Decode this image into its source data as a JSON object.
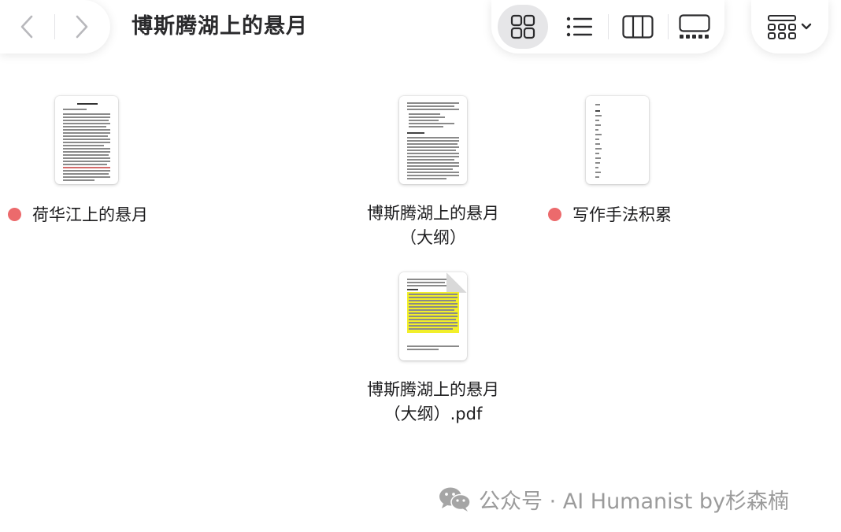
{
  "window": {
    "title": "博斯腾湖上的悬月"
  },
  "toolbar": {
    "back_icon": "chevron-left-icon",
    "forward_icon": "chevron-right-icon",
    "views": [
      {
        "name": "icon-view",
        "icon": "grid-icon",
        "active": true
      },
      {
        "name": "list-view",
        "icon": "list-icon",
        "active": false
      },
      {
        "name": "column-view",
        "icon": "columns-icon",
        "active": false
      },
      {
        "name": "gallery-view",
        "icon": "gallery-icon",
        "active": false
      }
    ],
    "group_icon": "group-by-icon",
    "group_chevron": "chevron-down-icon"
  },
  "files": [
    {
      "name": "荷华江上的悬月",
      "tag_color": "#ec6a6c",
      "kind": "document"
    },
    {
      "name_line1": "博斯腾湖上的悬月",
      "name_line2": "（大纲）",
      "kind": "document"
    },
    {
      "name": "写作手法积累",
      "tag_color": "#ec6a6c",
      "kind": "document"
    },
    {
      "name_line1": "博斯腾湖上的悬月",
      "name_line2": "（大纲）.pdf",
      "kind": "pdf",
      "highlight_color": "#f2ef2a"
    }
  ],
  "watermark": {
    "text": "公众号 · AI Humanist by杉森楠",
    "icon": "wechat-icon"
  }
}
